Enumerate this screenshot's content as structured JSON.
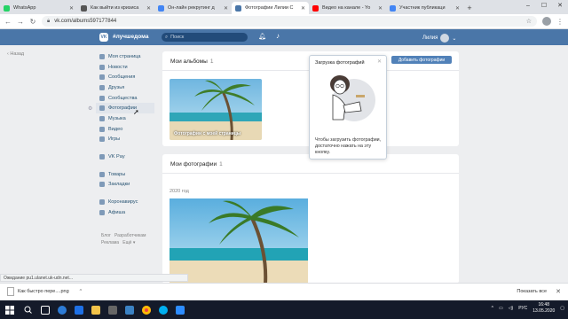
{
  "browser": {
    "tabs": [
      {
        "label": "WhatsApp",
        "color": "#25d366",
        "active": false
      },
      {
        "label": "Как выйти из кризиса",
        "color": "#555555",
        "active": false
      },
      {
        "label": "Он-лайн рекрутинг д",
        "color": "#4285f4",
        "active": false
      },
      {
        "label": "Фотографии Лилии С",
        "color": "#4a76a8",
        "active": true
      },
      {
        "label": "Видео на канале - Yo",
        "color": "#ff0000",
        "active": false
      },
      {
        "label": "Участник публикаци",
        "color": "#4285f4",
        "active": false
      }
    ],
    "url": "vk.com/albums597177844",
    "status_text": "Ожидание pu1.ulanet.uk-udn.net..."
  },
  "vk": {
    "logo_text": "VK",
    "hashtag": "#лучшедома",
    "search_placeholder": "Поиск",
    "user_name": "Лилия",
    "back_label": "Назад",
    "nav": [
      {
        "label": "Моя страница",
        "icon": "home-icon"
      },
      {
        "label": "Новости",
        "icon": "news-icon"
      },
      {
        "label": "Сообщения",
        "icon": "messages-icon"
      },
      {
        "label": "Друзья",
        "icon": "friends-icon"
      },
      {
        "label": "Сообщества",
        "icon": "communities-icon"
      },
      {
        "label": "Фотографии",
        "icon": "photos-icon",
        "selected": true
      },
      {
        "label": "Музыка",
        "icon": "music-icon"
      },
      {
        "label": "Видео",
        "icon": "video-icon"
      },
      {
        "label": "Игры",
        "icon": "games-icon"
      }
    ],
    "nav2": [
      {
        "label": "VK Pay",
        "icon": "vkpay-icon"
      }
    ],
    "nav3": [
      {
        "label": "Товары",
        "icon": "goods-icon"
      },
      {
        "label": "Закладки",
        "icon": "bookmarks-icon"
      }
    ],
    "nav4": [
      {
        "label": "Коронавирус",
        "icon": "coronavirus-icon"
      },
      {
        "label": "Афиша",
        "icon": "events-icon"
      }
    ],
    "footer_links": [
      "Блог",
      "Разработчикам",
      "Реклама",
      "Ещё"
    ],
    "albums": {
      "title": "Мои альбомы",
      "count": "1",
      "add_button": "Добавить фотографии",
      "album_caption": "Фотографии с моей страницы"
    },
    "photos": {
      "title": "Мои фотографии",
      "count": "1",
      "year": "2020 год"
    },
    "tooltip": {
      "title": "Загрузка фотографий",
      "text": "Чтобы загрузить фотографии, достаточно нажать на эту кнопку."
    }
  },
  "downloads": {
    "file": "Как быстро пере....png",
    "show_all": "Показать все"
  },
  "taskbar": {
    "lang": "РУС",
    "time": "16:48",
    "date": "13.05.2020"
  }
}
